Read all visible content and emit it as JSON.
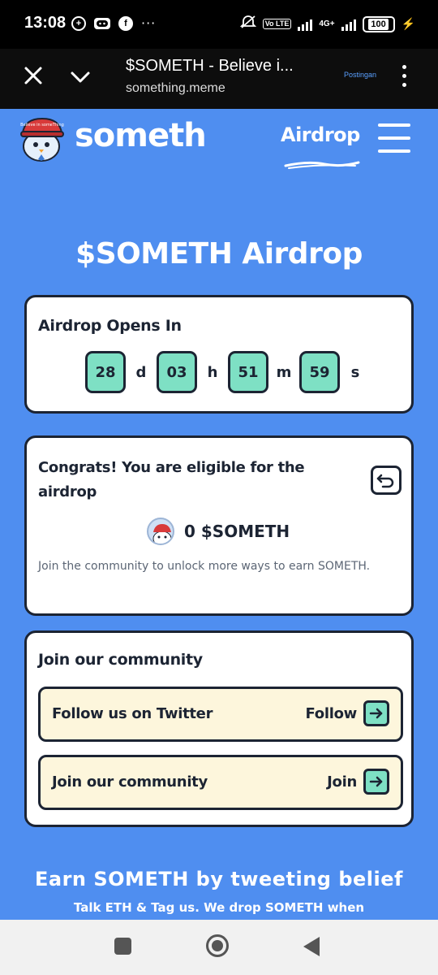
{
  "status_bar": {
    "time": "13:08",
    "network": "4G+",
    "battery": "100",
    "volte": "Vo LTE"
  },
  "browser": {
    "title": "$SOMETH - Believe i...",
    "url": "something.meme",
    "extra": "Postingan"
  },
  "header": {
    "brand": "someth",
    "nav_link": "Airdrop",
    "logo_hat_text": "Believe in someThing"
  },
  "page_title": "$SOMETH Airdrop",
  "timer": {
    "heading": "Airdrop Opens In",
    "days": "28",
    "days_unit": "d",
    "hours": "03",
    "hours_unit": "h",
    "minutes": "51",
    "minutes_unit": "m",
    "seconds": "59",
    "seconds_unit": "s"
  },
  "eligibility": {
    "text": "Congrats! You are eligible for the airdrop",
    "amount": "0 $SOMETH",
    "note": "Join the community to unlock more ways to earn SOMETH."
  },
  "community": {
    "heading": "Join our community",
    "rows": [
      {
        "label": "Follow us on Twitter",
        "action": "Follow"
      },
      {
        "label": "Join our community",
        "action": "Join"
      }
    ]
  },
  "earn": {
    "title": "Earn SOMETH by tweeting belief",
    "subtitle": "Talk ETH & Tag us. We drop SOMETH when"
  },
  "colors": {
    "page_bg": "#4f8ef0",
    "card_border": "#1c2433",
    "accent_teal": "#7ee0c4",
    "row_bg": "#fdf6dc"
  }
}
